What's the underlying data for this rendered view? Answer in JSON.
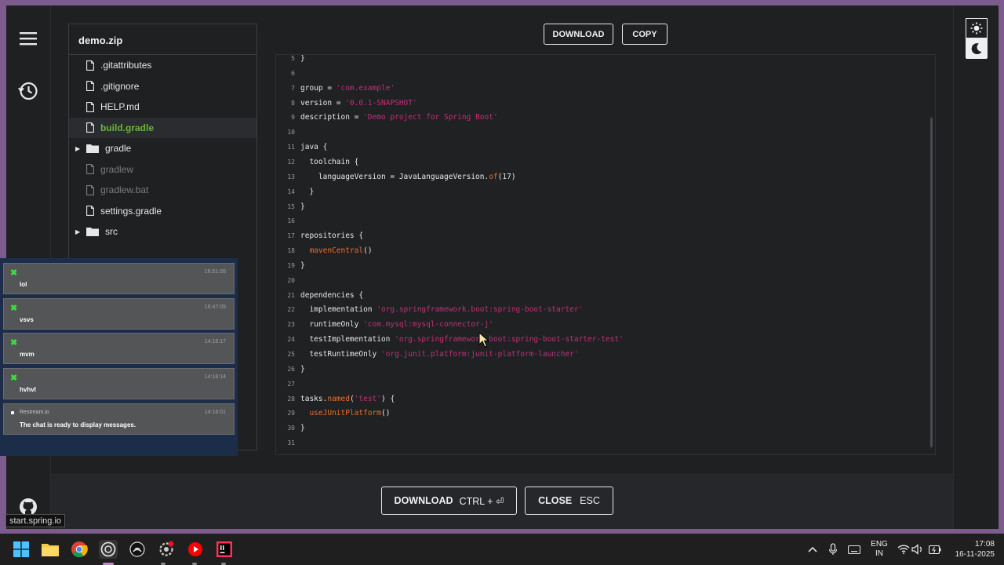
{
  "tree": {
    "title": "demo.zip",
    "items": [
      {
        "label": ".gitattributes",
        "kind": "file",
        "state": "normal"
      },
      {
        "label": ".gitignore",
        "kind": "file",
        "state": "normal"
      },
      {
        "label": "HELP.md",
        "kind": "file",
        "state": "normal"
      },
      {
        "label": "build.gradle",
        "kind": "file",
        "state": "selected"
      },
      {
        "label": "gradle",
        "kind": "folder",
        "state": "normal"
      },
      {
        "label": "gradlew",
        "kind": "file",
        "state": "dim"
      },
      {
        "label": "gradlew.bat",
        "kind": "file",
        "state": "dim"
      },
      {
        "label": "settings.gradle",
        "kind": "file",
        "state": "normal"
      },
      {
        "label": "src",
        "kind": "folder",
        "state": "normal"
      }
    ]
  },
  "toolbar": {
    "download_label": "DOWNLOAD",
    "copy_label": "COPY"
  },
  "code": {
    "lines": [
      {
        "n": "5",
        "parts": [
          [
            "t",
            "}"
          ]
        ]
      },
      {
        "n": "6",
        "parts": []
      },
      {
        "n": "7",
        "parts": [
          [
            "t",
            "group = "
          ],
          [
            "s",
            "'com.example'"
          ]
        ]
      },
      {
        "n": "8",
        "parts": [
          [
            "t",
            "version = "
          ],
          [
            "s",
            "'0.0.1-SNAPSHOT'"
          ]
        ]
      },
      {
        "n": "9",
        "parts": [
          [
            "t",
            "description = "
          ],
          [
            "s",
            "'Demo project for Spring Boot'"
          ]
        ]
      },
      {
        "n": "10",
        "parts": []
      },
      {
        "n": "11",
        "parts": [
          [
            "t",
            "java {"
          ]
        ]
      },
      {
        "n": "12",
        "parts": [
          [
            "t",
            "  toolchain {"
          ]
        ]
      },
      {
        "n": "13",
        "parts": [
          [
            "t",
            "    languageVersion = JavaLanguageVersion."
          ],
          [
            "f",
            "of"
          ],
          [
            "t",
            "(17)"
          ]
        ]
      },
      {
        "n": "14",
        "parts": [
          [
            "t",
            "  }"
          ]
        ]
      },
      {
        "n": "15",
        "parts": [
          [
            "t",
            "}"
          ]
        ]
      },
      {
        "n": "16",
        "parts": []
      },
      {
        "n": "17",
        "parts": [
          [
            "t",
            "repositories {"
          ]
        ]
      },
      {
        "n": "18",
        "parts": [
          [
            "t",
            "  "
          ],
          [
            "f",
            "mavenCentral"
          ],
          [
            "t",
            "()"
          ]
        ]
      },
      {
        "n": "19",
        "parts": [
          [
            "t",
            "}"
          ]
        ]
      },
      {
        "n": "20",
        "parts": []
      },
      {
        "n": "21",
        "parts": [
          [
            "t",
            "dependencies {"
          ]
        ]
      },
      {
        "n": "22",
        "parts": [
          [
            "t",
            "  implementation "
          ],
          [
            "s",
            "'org.springframework.boot:spring-boot-starter'"
          ]
        ]
      },
      {
        "n": "23",
        "parts": [
          [
            "t",
            "  runtimeOnly "
          ],
          [
            "s",
            "'com.mysql:mysql-connector-j'"
          ]
        ]
      },
      {
        "n": "24",
        "parts": [
          [
            "t",
            "  testImplementation "
          ],
          [
            "s",
            "'org.springframework.boot:spring-boot-starter-test'"
          ]
        ]
      },
      {
        "n": "25",
        "parts": [
          [
            "t",
            "  testRuntimeOnly "
          ],
          [
            "s",
            "'org.junit.platform:junit-platform-launcher'"
          ]
        ]
      },
      {
        "n": "26",
        "parts": [
          [
            "t",
            "}"
          ]
        ]
      },
      {
        "n": "27",
        "parts": []
      },
      {
        "n": "28",
        "parts": [
          [
            "t",
            "tasks."
          ],
          [
            "f",
            "named"
          ],
          [
            "t",
            "("
          ],
          [
            "s",
            "'test'"
          ],
          [
            "t",
            ") {"
          ]
        ]
      },
      {
        "n": "29",
        "parts": [
          [
            "t",
            "  "
          ],
          [
            "f",
            "useJUnitPlatform"
          ],
          [
            "t",
            "()"
          ]
        ]
      },
      {
        "n": "30",
        "parts": [
          [
            "t",
            "}"
          ]
        ]
      },
      {
        "n": "31",
        "parts": []
      }
    ]
  },
  "footer": {
    "download_label": "DOWNLOAD",
    "download_shortcut": "CTRL + ⏎",
    "close_label": "CLOSE",
    "close_shortcut": "ESC"
  },
  "chat": {
    "messages": [
      {
        "time": "16:51:05",
        "text": "lol"
      },
      {
        "time": "16:47:05",
        "text": "vsvs"
      },
      {
        "time": "14:18:17",
        "text": "mvm"
      },
      {
        "time": "14:18:14",
        "text": "hvhvl"
      }
    ],
    "system": {
      "source": "Restream.io",
      "time": "14:18:01",
      "text": "The chat is ready to display messages."
    }
  },
  "tooltip": "start.spring.io",
  "tray": {
    "lang_line1": "ENG",
    "lang_line2": "IN",
    "time": "17:08",
    "date": "16-11-2025"
  },
  "colors": {
    "accent_green": "#6db33f",
    "string": "#c0307a",
    "function": "#e6702e"
  }
}
